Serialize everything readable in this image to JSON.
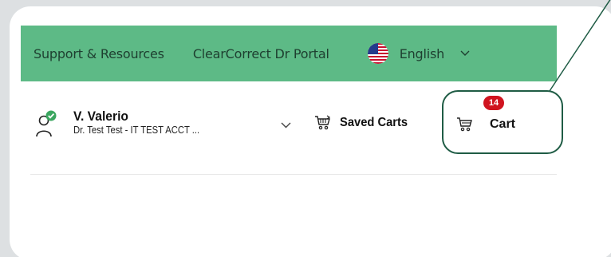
{
  "nav": {
    "support_label": "Support & Resources",
    "portal_label": "ClearCorrect Dr Portal",
    "language_label": "English",
    "flag_icon": "us-flag-icon",
    "chevron_icon": "chevron-down-icon"
  },
  "user": {
    "name": "V. Valerio",
    "account": "Dr. Test Test - IT TEST ACCT ...",
    "status_icon": "verified-user-icon"
  },
  "actions": {
    "saved_carts_label": "Saved Carts",
    "cart_label": "Cart",
    "cart_count": "14"
  },
  "colors": {
    "nav_background": "#5dba86",
    "badge": "#d0141f",
    "highlight_border": "#1f5c45",
    "verified_check": "#3aa65f"
  }
}
